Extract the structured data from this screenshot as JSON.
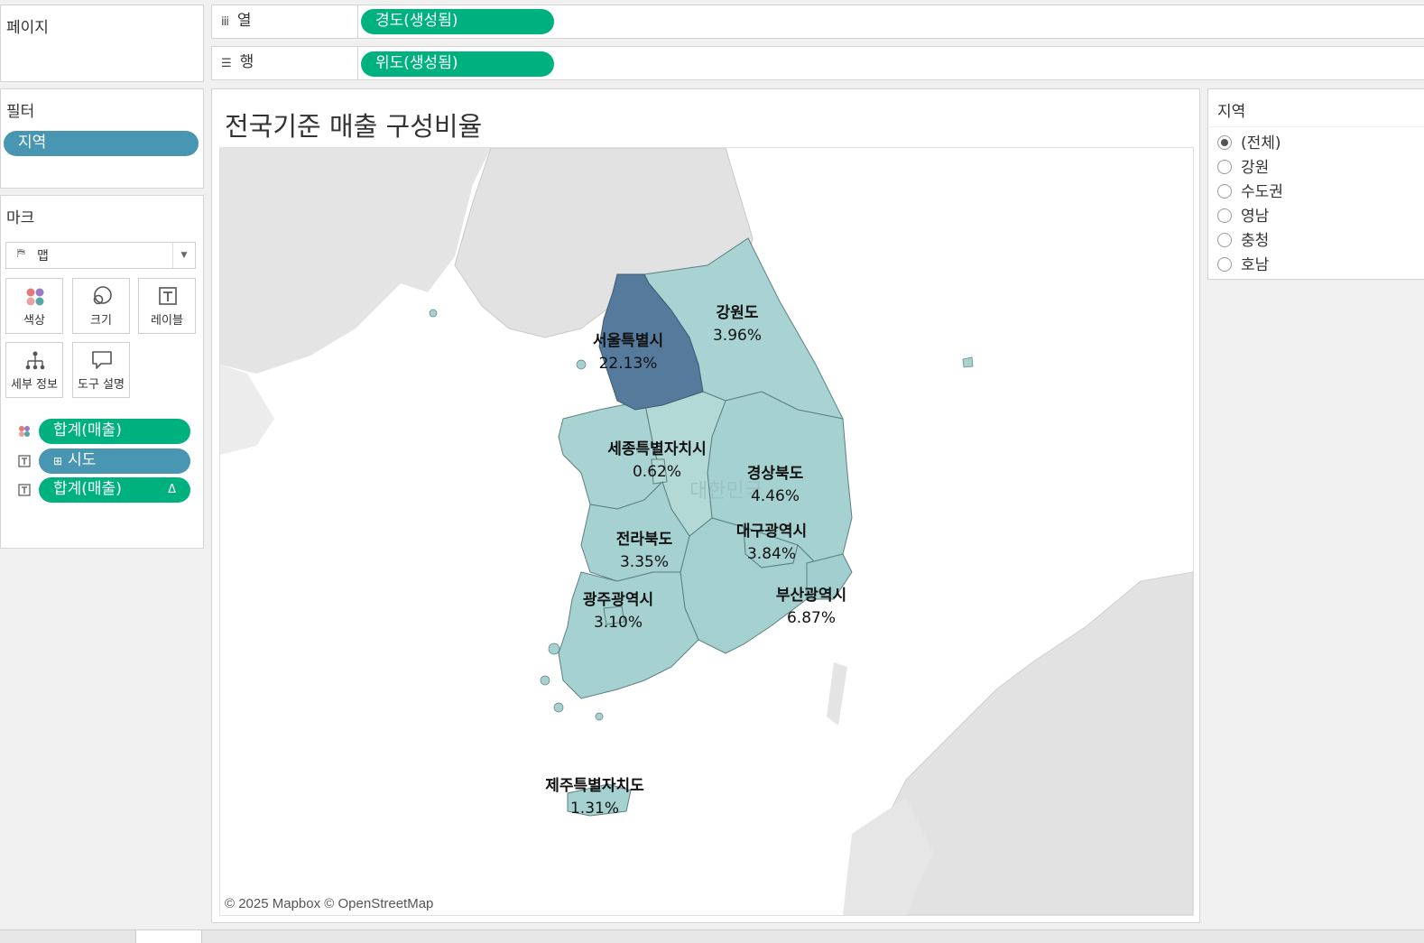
{
  "pages": {
    "title": "페이지"
  },
  "shelves": {
    "columns": {
      "label": "열",
      "icon": "columns-icon",
      "pill": "경도(생성됨)"
    },
    "rows": {
      "label": "행",
      "icon": "rows-icon",
      "pill": "위도(생성됨)"
    }
  },
  "filters": {
    "title": "필터",
    "items": [
      "지역"
    ]
  },
  "marks": {
    "title": "마크",
    "type_select": "맵",
    "buttons": [
      {
        "label": "색상",
        "icon": "color-icon"
      },
      {
        "label": "크기",
        "icon": "size-icon"
      },
      {
        "label": "레이블",
        "icon": "label-icon"
      },
      {
        "label": "세부 정보",
        "icon": "detail-icon"
      },
      {
        "label": "도구 설명",
        "icon": "tooltip-icon"
      }
    ],
    "fields": [
      {
        "label": "합계(매출)",
        "encoding": "color",
        "color": "#00b180"
      },
      {
        "label": "시도",
        "encoding": "label",
        "prefix": "⊞",
        "color": "#4996b2"
      },
      {
        "label": "합계(매출)",
        "encoding": "label",
        "suffix": "Δ",
        "color": "#00b180"
      }
    ]
  },
  "view": {
    "title": "전국기준 매출 구성비율",
    "attribution": "© 2025 Mapbox © OpenStreetMap",
    "watermark": "대한민국",
    "regions": [
      {
        "name": "서울특별시",
        "value": "22.13%"
      },
      {
        "name": "강원도",
        "value": "3.96%"
      },
      {
        "name": "세종특별자치시",
        "value": "0.62%"
      },
      {
        "name": "경상북도",
        "value": "4.46%"
      },
      {
        "name": "대구광역시",
        "value": "3.84%"
      },
      {
        "name": "전라북도",
        "value": "3.35%"
      },
      {
        "name": "부산광역시",
        "value": "6.87%"
      },
      {
        "name": "광주광역시",
        "value": "3.10%"
      },
      {
        "name": "제주특별자치도",
        "value": "1.31%"
      }
    ],
    "colors": {
      "high": "#557a9c",
      "low": "#a6d2d2",
      "mid": "#b4d9d6",
      "land": "#e2e2e2",
      "sea": "#ffffff"
    }
  },
  "region_filter": {
    "title": "지역",
    "options": [
      "(전체)",
      "강원",
      "수도권",
      "영남",
      "충청",
      "호남"
    ],
    "selected": "(전체)"
  }
}
